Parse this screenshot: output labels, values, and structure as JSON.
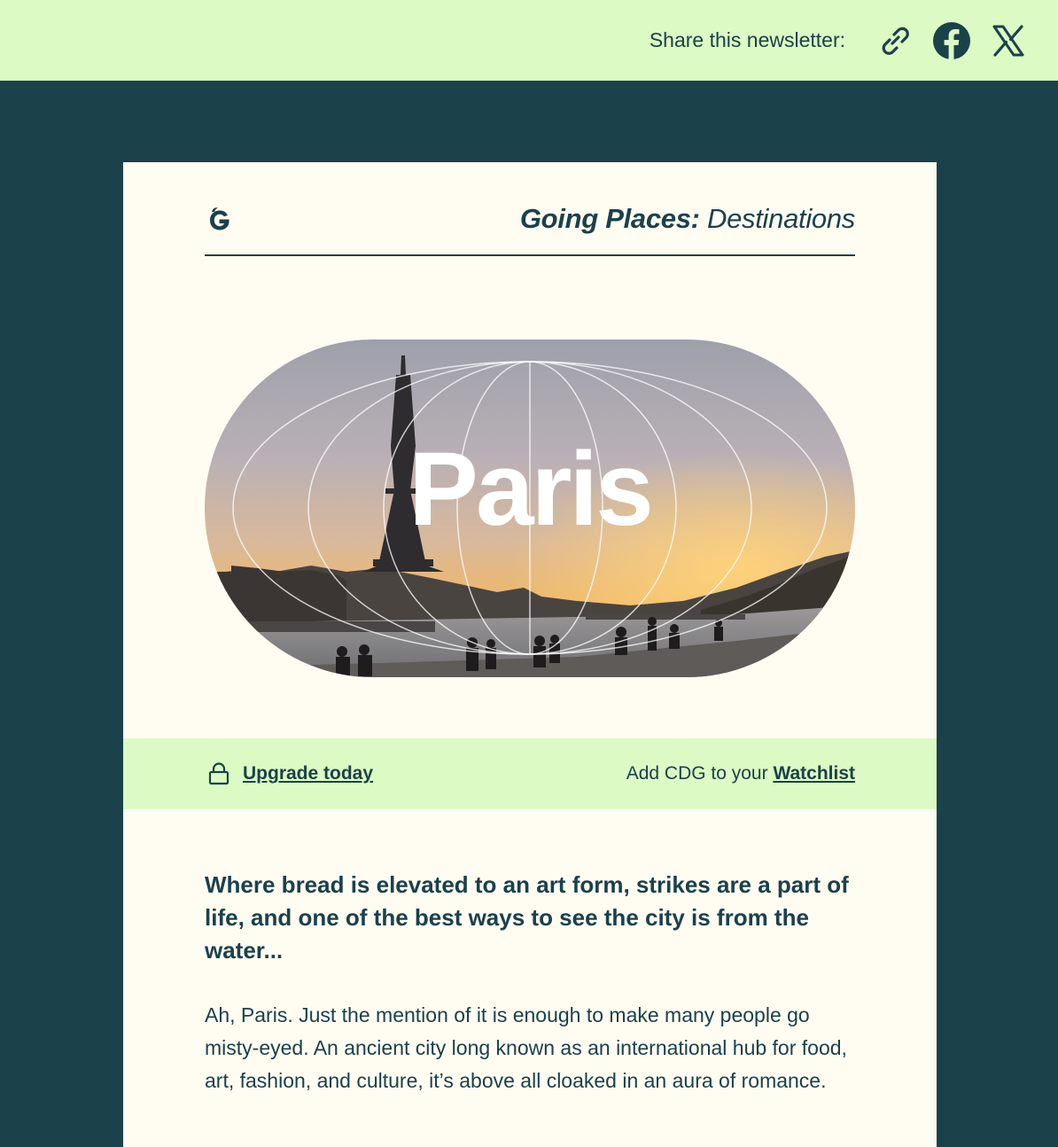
{
  "share": {
    "label": "Share this newsletter:",
    "icons": [
      "link-icon",
      "facebook-icon",
      "x-icon"
    ]
  },
  "masthead": {
    "title_bold": "Going Places:",
    "title_rest": " Destinations",
    "logo": "going-logo-icon"
  },
  "hero": {
    "city": "Paris"
  },
  "banner": {
    "upgrade_label": "Upgrade today",
    "watch_prefix": "Add CDG to your ",
    "watch_link": "Watchlist"
  },
  "article": {
    "headline": "Where bread is elevated to an art form, strikes are a part of life, and one of the best ways to see the city is from the water...",
    "intro": "Ah, Paris. Just the mention of it is enough to make many people go misty-eyed. An ancient city long known as an international hub for food, art, fashion, and culture, it’s above all cloaked in an aura of romance."
  },
  "colors": {
    "page_bg": "#1b414a",
    "accent_green": "#dcfac4",
    "card_bg": "#fffdf2",
    "text": "#1b414a"
  }
}
